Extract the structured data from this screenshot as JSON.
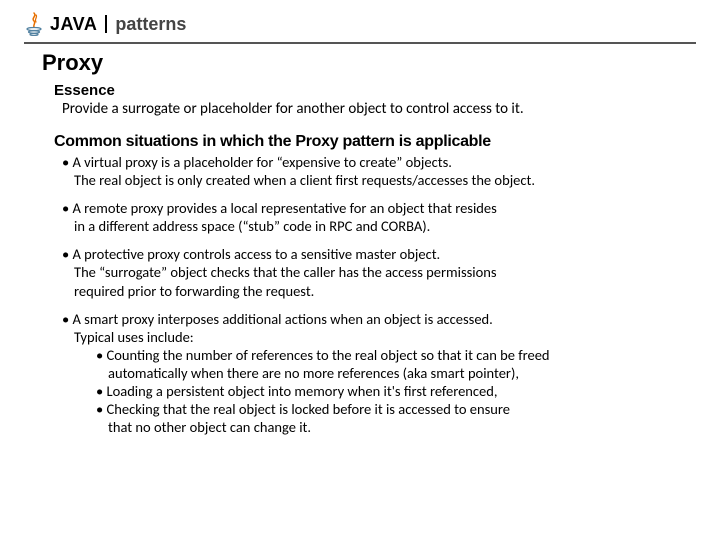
{
  "header": {
    "java": "JAVA",
    "patterns": "patterns"
  },
  "title": "Proxy",
  "essence": {
    "heading": "Essence",
    "body": "Provide a surrogate or placeholder for another object to control access to it."
  },
  "situations": {
    "heading": "Common situations in which the Proxy pattern is applicable",
    "items": [
      {
        "l1": "• A virtual proxy is a placeholder for “expensive to create” objects.",
        "l2": "The real object is only created when a client first requests/accesses the object."
      },
      {
        "l1": "• A remote proxy provides a local representative for an object that resides",
        "l2": "in a different address space (“stub” code in RPC and CORBA)."
      },
      {
        "l1": "• A protective proxy controls access to a sensitive master object.",
        "l2": "The “surrogate” object checks that the caller has the access permissions",
        "l3": "required prior to forwarding the request."
      },
      {
        "l1": "• A smart proxy interposes additional actions when an object is accessed.",
        "l2": "Typical uses include:",
        "subs": [
          {
            "s1": "• Counting the number of references to the real object so that it can be freed",
            "s2": "automatically when there are no more references (aka smart pointer),"
          },
          {
            "s1": "• Loading a persistent object into memory when it's first referenced,"
          },
          {
            "s1": "• Checking that the real object is locked before it is accessed to ensure",
            "s2": "that no other object can change it."
          }
        ]
      }
    ]
  }
}
